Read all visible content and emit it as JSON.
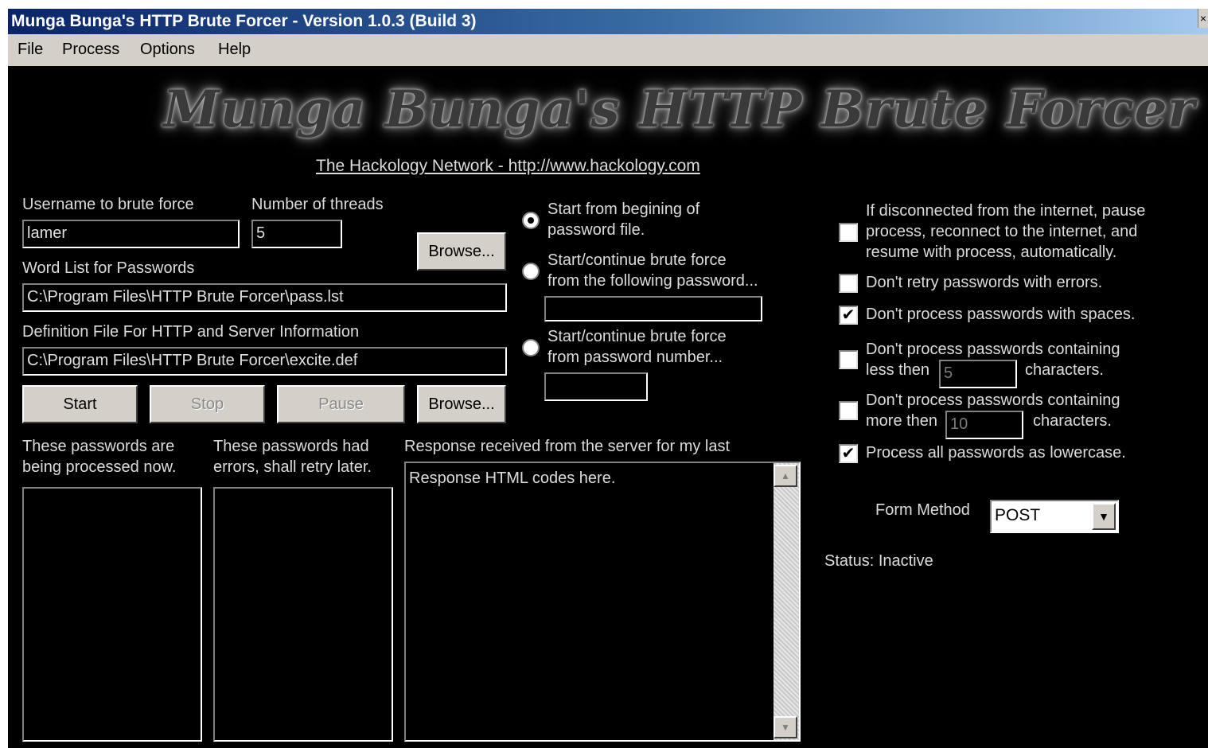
{
  "window": {
    "title": "Munga Bunga's HTTP Brute Forcer - Version 1.0.3 (Build 3)",
    "close_glyph": "×"
  },
  "menu": {
    "items": [
      "File",
      "Process",
      "Options",
      "Help"
    ]
  },
  "header": {
    "logo_text": "Munga Bunga's HTTP Brute Forcer",
    "link_text": "The Hackology Network - http://www.hackology.com"
  },
  "form": {
    "username_label": "Username to brute force",
    "username_value": "lamer",
    "threads_label": "Number of threads",
    "threads_value": "5",
    "wordlist_label": "Word List for Passwords",
    "wordlist_value": "C:\\Program Files\\HTTP Brute Forcer\\pass.lst",
    "deffile_label": "Definition File For HTTP and Server Information",
    "deffile_value": "C:\\Program Files\\HTTP Brute Forcer\\excite.def",
    "browse_label": "Browse...",
    "browse2_label": "Browse..."
  },
  "buttons": {
    "start": "Start",
    "stop": "Stop",
    "pause": "Pause"
  },
  "radios": {
    "opt1_line1": "Start from begining of",
    "opt1_line2": "password file.",
    "opt2_line1": "Start/continue brute force",
    "opt2_line2": "from the following password...",
    "opt2_value": "",
    "opt3_line1": "Start/continue brute force",
    "opt3_line2": "from password number...",
    "opt3_value": ""
  },
  "lists": {
    "processing_line1": "These passwords are",
    "processing_line2": "being processed now.",
    "errors_line1": "These passwords had",
    "errors_line2": "errors, shall retry later.",
    "response_label": "Response received from the server for my last",
    "response_text": "Response HTML codes here."
  },
  "options": {
    "reconnect_line1": "If disconnected from the internet, pause",
    "reconnect_line2": "process, reconnect to the internet, and",
    "reconnect_line3": "resume with process, automatically.",
    "no_retry": "Don't retry passwords with errors.",
    "no_spaces": "Don't process passwords with spaces.",
    "minlen_line1": "Don't process passwords containing",
    "minlen_pre": "less then",
    "minlen_value": "5",
    "minlen_post": "characters.",
    "maxlen_line1": "Don't process passwords containing",
    "maxlen_pre": "more then",
    "maxlen_value": "10",
    "maxlen_post": "characters.",
    "lowercase": "Process all passwords as lowercase.",
    "checked_mark": "✔"
  },
  "form_method": {
    "label": "Form Method",
    "value": "POST",
    "arrow": "▼"
  },
  "status": {
    "text": "Status: Inactive"
  },
  "scrollbar": {
    "up": "▲",
    "down": "▼"
  },
  "colors": {
    "title_bar": "#0a246a",
    "background": "#000000",
    "text": "#dcdcdc",
    "button_face": "#d4d0c8"
  }
}
